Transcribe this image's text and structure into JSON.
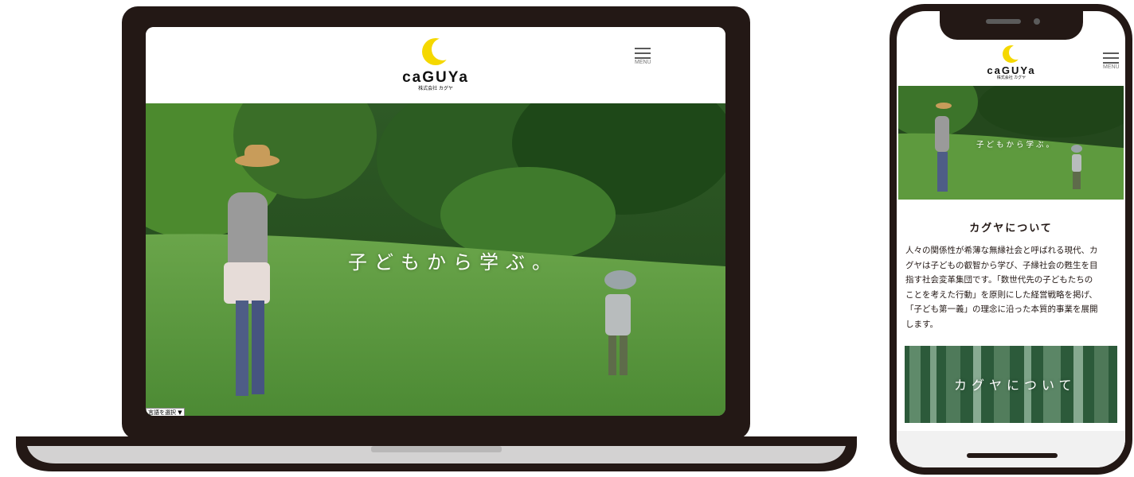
{
  "laptop": {
    "brand": {
      "name": "caGUYa",
      "sub": "株式会社 カグヤ"
    },
    "menu_label": "MENU",
    "hero_text": "子どもから学ぶ。",
    "language_select": "言語を選択 ▼"
  },
  "phone": {
    "brand": {
      "name": "caGUYa",
      "sub": "株式会社 カグヤ"
    },
    "menu_label": "MENU",
    "hero_text": "子どもから学ぶ。",
    "section_title": "カグヤについて",
    "body_lines": [
      "人々の関係性が希薄な無縁社会と呼ばれる現代、カ",
      "グヤは子どもの叡智から学び、子縁社会の甦生を目",
      "指す社会変革集団です。「数世代先の子どもたちの",
      "ことを考えた行動」を原則にした経営戦略を掲げ、",
      "「子ども第一義」の理念に沿った本質的事業を展開",
      "します。"
    ],
    "banner_text": "カグヤについて"
  },
  "colors": {
    "frame": "#231815",
    "logo_moon": "#f5d800",
    "grass": "#5e9a3e",
    "forest": "#2a5a22"
  }
}
